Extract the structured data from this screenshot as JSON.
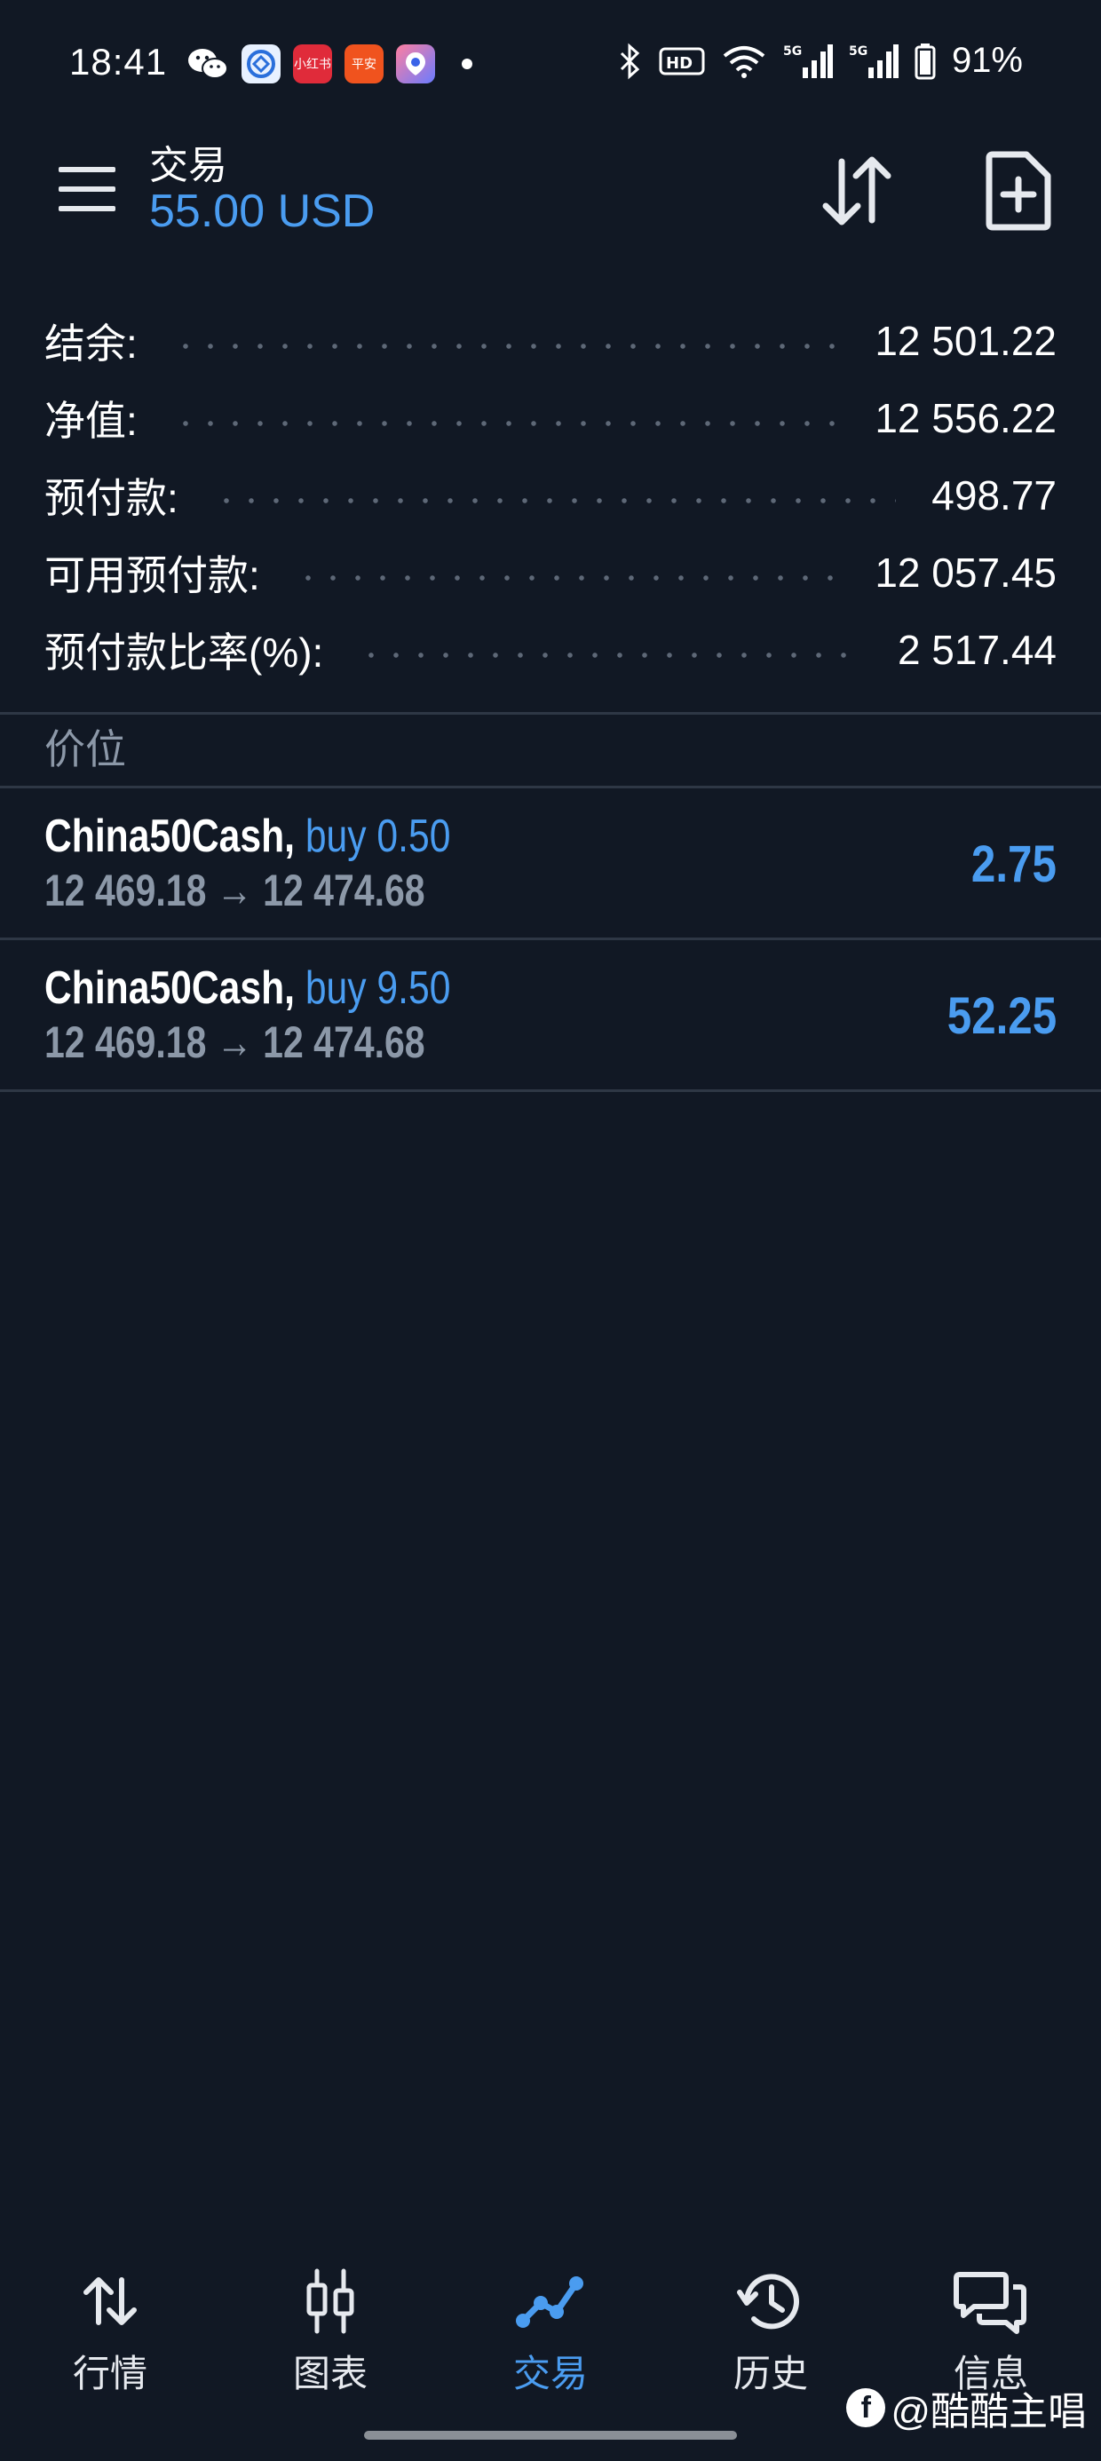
{
  "status_bar": {
    "time": "18:41",
    "battery": "91%",
    "app_icons": [
      "wechat-icon",
      "app-icon",
      "xiaohongshu-icon",
      "pingan-bank-icon",
      "app-icon"
    ]
  },
  "header": {
    "title": "交易",
    "balance": "55.00 USD"
  },
  "summary": [
    {
      "label": "结余:",
      "value": "12 501.22"
    },
    {
      "label": "净值:",
      "value": "12 556.22"
    },
    {
      "label": "预付款:",
      "value": "498.77"
    },
    {
      "label": "可用预付款:",
      "value": "12 057.45"
    },
    {
      "label": "预付款比率(%):",
      "value": "2 517.44"
    }
  ],
  "section_title": "价位",
  "positions": [
    {
      "symbol": "China50Cash,",
      "side": "buy 0.50",
      "prices": "12 469.18 → 12 474.68",
      "profit": "2.75"
    },
    {
      "symbol": "China50Cash,",
      "side": "buy 9.50",
      "prices": "12 469.18 → 12 474.68",
      "profit": "52.25"
    }
  ],
  "bottom_nav": [
    {
      "label": "行情",
      "icon": "quotes-icon",
      "active": false
    },
    {
      "label": "图表",
      "icon": "chart-icon",
      "active": false
    },
    {
      "label": "交易",
      "icon": "trade-icon",
      "active": true
    },
    {
      "label": "历史",
      "icon": "history-icon",
      "active": false
    },
    {
      "label": "信息",
      "icon": "messages-icon",
      "active": false
    }
  ],
  "watermark": "@酷酷主唱",
  "colors": {
    "background": "#111824",
    "accent": "#4a9cf0",
    "muted": "#8c98a8",
    "divider": "#2e3745"
  }
}
